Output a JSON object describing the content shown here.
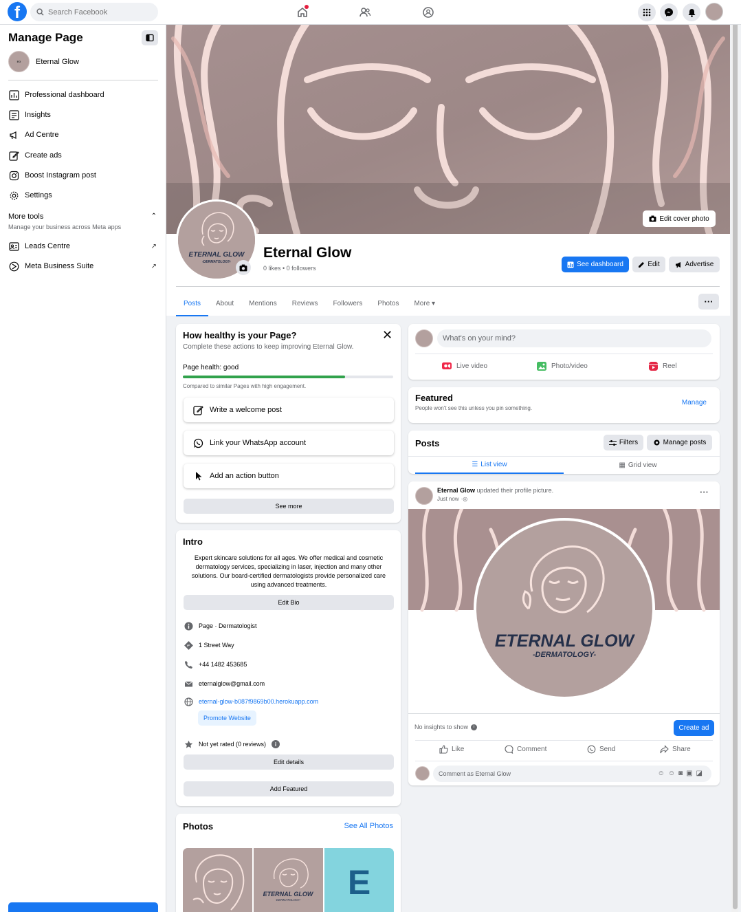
{
  "topbar": {
    "logo": "f",
    "search_placeholder": "Search Facebook",
    "nav_icons": [
      "home-icon",
      "friends-icon",
      "groups-icon"
    ],
    "right_icons": [
      "menu-grid-icon",
      "messenger-icon",
      "bell-icon",
      "account-avatar"
    ]
  },
  "sidebar": {
    "title": "Manage Page",
    "page_name": "Eternal Glow",
    "items": [
      {
        "label": "Professional dashboard",
        "icon": "dashboard-icon"
      },
      {
        "label": "Insights",
        "icon": "insights-icon"
      },
      {
        "label": "Ad Centre",
        "icon": "megaphone-icon"
      },
      {
        "label": "Create ads",
        "icon": "pencil-icon"
      },
      {
        "label": "Boost Instagram post",
        "icon": "instagram-icon"
      },
      {
        "label": "Settings",
        "icon": "gear-icon"
      }
    ],
    "more_tools": {
      "title": "More tools",
      "subtitle": "Manage your business across Meta apps",
      "items": [
        {
          "label": "Leads Centre",
          "icon": "leads-icon"
        },
        {
          "label": "Meta Business Suite",
          "icon": "meta-icon"
        }
      ]
    }
  },
  "header": {
    "edit_cover": "Edit cover photo",
    "page_name": "Eternal Glow",
    "stats": "0 likes • 0 followers",
    "see_dashboard": "See dashboard",
    "edit": "Edit",
    "advertise": "Advertise",
    "tabs": [
      "Posts",
      "About",
      "Mentions",
      "Reviews",
      "Followers",
      "Photos",
      "More ▾"
    ],
    "more_dots": "···"
  },
  "health": {
    "title": "How healthy is your Page?",
    "subtitle": "Complete these actions to keep improving Eternal Glow.",
    "status": "Page health: good",
    "progress": 0.77,
    "compare": "Compared to similar Pages with high engagement.",
    "actions": [
      "Write a welcome post",
      "Link your WhatsApp account",
      "Add an action button"
    ],
    "see_more": "See more"
  },
  "intro": {
    "title": "Intro",
    "bio": "Expert skincare solutions for all ages. We offer medical and cosmetic dermatology services, specializing in laser, injection and many other solutions. Our board-certified dermatologists provide personalized care using advanced treatments.",
    "edit_bio": "Edit Bio",
    "category": "Page · Dermatologist",
    "address": "1 Street Way",
    "phone": "+44 1482 453685",
    "email": "eternalglow@gmail.com",
    "website": "eternal-glow-b087f9869b00.herokuapp.com",
    "promote": "Promote Website",
    "rating": "Not yet rated (0 reviews)",
    "edit_details": "Edit details",
    "add_featured": "Add Featured"
  },
  "photos": {
    "title": "Photos",
    "see_all": "See All Photos",
    "third_letter": "E",
    "logo_text": "ETERNAL GLOW",
    "logo_sub": "-DERMATOLOGY-"
  },
  "composer": {
    "placeholder": "What's on your mind?",
    "live": "Live video",
    "photo": "Photo/video",
    "reel": "Reel"
  },
  "featured": {
    "title": "Featured",
    "subtitle": "People won't see this unless you pin something.",
    "manage": "Manage"
  },
  "posts": {
    "title": "Posts",
    "filters": "Filters",
    "manage_posts": "Manage posts",
    "list_view": "List view",
    "grid_view": "Grid view"
  },
  "post": {
    "author": "Eternal Glow",
    "action": "updated their profile picture.",
    "time": "Just now",
    "logo_text": "ETERNAL GLOW",
    "logo_sub": "-DERMATOLOGY-",
    "insights": "No insights to show",
    "create_ad": "Create ad",
    "like": "Like",
    "comment": "Comment",
    "send": "Send",
    "share": "Share",
    "comment_placeholder": "Comment as Eternal Glow"
  },
  "colors": {
    "brand": "#1877f2",
    "health_bar": "#31a24c",
    "logo_bg": "#b3a09e"
  }
}
